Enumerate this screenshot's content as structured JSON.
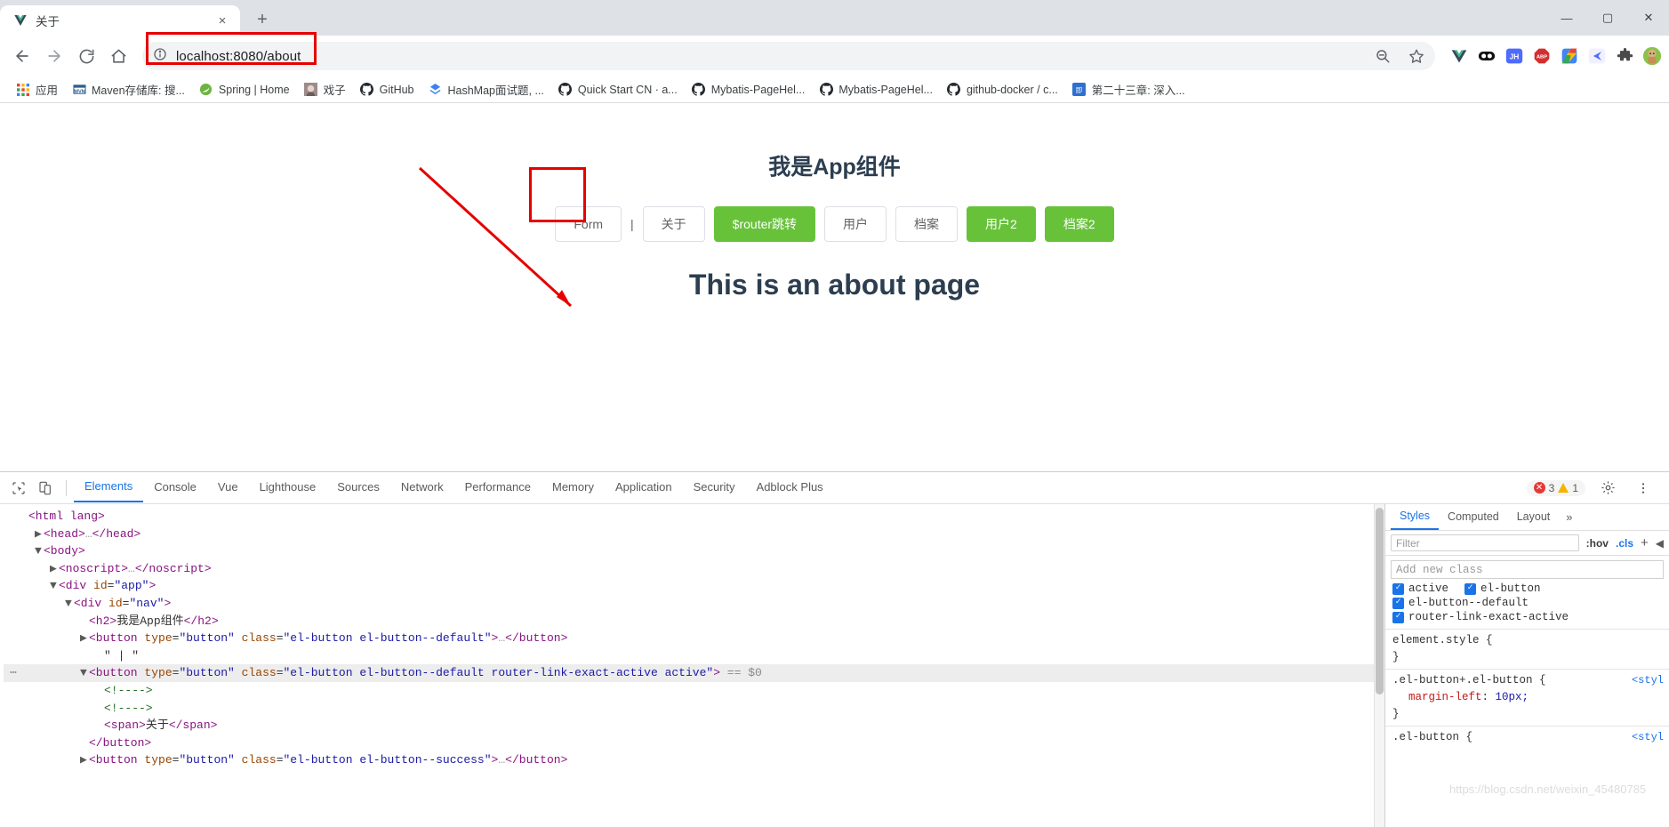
{
  "browser": {
    "tab": {
      "title": "关于",
      "favicon": "vue-icon",
      "close_label": "×"
    },
    "new_tab_label": "+",
    "window_controls": {
      "minimize": "—",
      "maximize": "▢",
      "close": "✕"
    },
    "nav": {
      "back": "←",
      "forward": "→",
      "reload": "⟳",
      "home": "⌂",
      "site_info": "ⓘ",
      "url": "localhost:8080/about",
      "zoom_icon": "search-minus-icon",
      "bookmark_star": "☆"
    },
    "extensions": [
      {
        "name": "vue-devtools-extension",
        "label": "V"
      },
      {
        "name": "dark-reader-extension",
        "label": "••"
      },
      {
        "name": "juejin-extension",
        "label": "JH"
      },
      {
        "name": "adblock-plus-extension",
        "label": "ABP"
      },
      {
        "name": "flash-extension",
        "label": "⚡"
      },
      {
        "name": "kite-extension",
        "label": "◀"
      },
      {
        "name": "extensions-puzzle",
        "label": "🧩"
      },
      {
        "name": "profile-avatar",
        "label": ""
      }
    ],
    "bookmarks": [
      {
        "label": "应用",
        "icon": "apps-grid-icon"
      },
      {
        "label": "Maven存储库: 搜...",
        "icon": "maven-icon"
      },
      {
        "label": "Spring | Home",
        "icon": "spring-leaf-icon"
      },
      {
        "label": "戏子",
        "icon": "anime-avatar-icon"
      },
      {
        "label": "GitHub",
        "icon": "github-icon"
      },
      {
        "label": "HashMap面试题, ...",
        "icon": "csdn-icon"
      },
      {
        "label": "Quick Start CN · a...",
        "icon": "github-icon"
      },
      {
        "label": "Mybatis-PageHel...",
        "icon": "github-icon"
      },
      {
        "label": "Mybatis-PageHel...",
        "icon": "github-icon"
      },
      {
        "label": "github-docker / c...",
        "icon": "github-icon"
      },
      {
        "label": "第二十三章: 深入...",
        "icon": "book-icon"
      }
    ]
  },
  "page": {
    "title": "我是App组件",
    "heading": "This is an about page",
    "separator": "|",
    "nav_buttons": [
      {
        "label": "Form",
        "type": "default"
      },
      {
        "label": "关于",
        "type": "default",
        "active": true
      },
      {
        "label": "$router跳转",
        "type": "success"
      },
      {
        "label": "用户",
        "type": "default"
      },
      {
        "label": "档案",
        "type": "default"
      },
      {
        "label": "用户2",
        "type": "success"
      },
      {
        "label": "档案2",
        "type": "success"
      }
    ]
  },
  "annotation": {
    "color": "#e60000"
  },
  "devtools": {
    "inspect_icon": "cursor-inspect-icon",
    "device_icon": "device-toolbar-icon",
    "tabs": [
      "Elements",
      "Console",
      "Vue",
      "Lighthouse",
      "Sources",
      "Network",
      "Performance",
      "Memory",
      "Application",
      "Security",
      "Adblock Plus"
    ],
    "active_tab": "Elements",
    "error_count": "3",
    "warning_count": "1",
    "settings_icon": "gear-icon",
    "menu_icon": "kebab-menu-icon",
    "dom_lines": [
      {
        "indent": 0,
        "parts": [
          {
            "c": "tw",
            "t": "<html lang>"
          }
        ],
        "clipped": true
      },
      {
        "indent": 1,
        "arrow": "▶",
        "parts": [
          {
            "c": "tw",
            "t": "<head>"
          },
          {
            "c": "dots",
            "t": "…"
          },
          {
            "c": "tw",
            "t": "</head>"
          }
        ]
      },
      {
        "indent": 1,
        "arrow": "▼",
        "parts": [
          {
            "c": "tw",
            "t": "<body>"
          }
        ]
      },
      {
        "indent": 2,
        "arrow": "▶",
        "parts": [
          {
            "c": "tw",
            "t": "<noscript>"
          },
          {
            "c": "dots",
            "t": "…"
          },
          {
            "c": "tw",
            "t": "</noscript>"
          }
        ]
      },
      {
        "indent": 2,
        "arrow": "▼",
        "parts": [
          {
            "c": "tw",
            "t": "<div "
          },
          {
            "c": "attr",
            "t": "id"
          },
          {
            "c": "eq",
            "t": "="
          },
          {
            "c": "val",
            "t": "\"app\""
          },
          {
            "c": "tw",
            "t": ">"
          }
        ]
      },
      {
        "indent": 3,
        "arrow": "▼",
        "parts": [
          {
            "c": "tw",
            "t": "<div "
          },
          {
            "c": "attr",
            "t": "id"
          },
          {
            "c": "eq",
            "t": "="
          },
          {
            "c": "val",
            "t": "\"nav\""
          },
          {
            "c": "tw",
            "t": ">"
          }
        ]
      },
      {
        "indent": 4,
        "parts": [
          {
            "c": "tw",
            "t": "<h2>"
          },
          {
            "c": "txt",
            "t": "我是App组件"
          },
          {
            "c": "tw",
            "t": "</h2>"
          }
        ]
      },
      {
        "indent": 4,
        "arrow": "▶",
        "parts": [
          {
            "c": "tw",
            "t": "<button "
          },
          {
            "c": "attr",
            "t": "type"
          },
          {
            "c": "eq",
            "t": "="
          },
          {
            "c": "val",
            "t": "\"button\""
          },
          {
            "c": "attr",
            "t": " class"
          },
          {
            "c": "eq",
            "t": "="
          },
          {
            "c": "val",
            "t": "\"el-button el-button--default\""
          },
          {
            "c": "tw",
            "t": ">"
          },
          {
            "c": "dots",
            "t": "…"
          },
          {
            "c": "tw",
            "t": "</button>"
          }
        ]
      },
      {
        "indent": 5,
        "parts": [
          {
            "c": "txt",
            "t": "\" | \""
          }
        ]
      },
      {
        "indent": 4,
        "arrow": "▼",
        "selected": true,
        "gutter": "⋯",
        "parts": [
          {
            "c": "tw",
            "t": "<button "
          },
          {
            "c": "attr",
            "t": "type"
          },
          {
            "c": "eq",
            "t": "="
          },
          {
            "c": "val",
            "t": "\"button\""
          },
          {
            "c": "attr",
            "t": " class"
          },
          {
            "c": "eq",
            "t": "="
          },
          {
            "c": "val",
            "t": "\"el-button el-button--default router-link-exact-active active\""
          },
          {
            "c": "tw",
            "t": ">"
          },
          {
            "c": "dollar",
            "t": " == $0"
          }
        ]
      },
      {
        "indent": 5,
        "parts": [
          {
            "c": "cmt",
            "t": "<!---->"
          }
        ]
      },
      {
        "indent": 5,
        "parts": [
          {
            "c": "cmt",
            "t": "<!---->"
          }
        ]
      },
      {
        "indent": 5,
        "parts": [
          {
            "c": "tw",
            "t": "<span>"
          },
          {
            "c": "txt",
            "t": "关于"
          },
          {
            "c": "tw",
            "t": "</span>"
          }
        ]
      },
      {
        "indent": 4,
        "parts": [
          {
            "c": "tw",
            "t": "</button>"
          }
        ]
      },
      {
        "indent": 4,
        "arrow": "▶",
        "parts": [
          {
            "c": "tw",
            "t": "<button "
          },
          {
            "c": "attr",
            "t": "type"
          },
          {
            "c": "eq",
            "t": "="
          },
          {
            "c": "val",
            "t": "\"button\""
          },
          {
            "c": "attr",
            "t": " class"
          },
          {
            "c": "eq",
            "t": "="
          },
          {
            "c": "val",
            "t": "\"el-button el-button--success\""
          },
          {
            "c": "tw",
            "t": ">"
          },
          {
            "c": "dots",
            "t": "…"
          },
          {
            "c": "tw",
            "t": "</button>"
          }
        ],
        "clipped": true
      }
    ],
    "styles": {
      "tabs": [
        "Styles",
        "Computed",
        "Layout"
      ],
      "more": "»",
      "active_tab": "Styles",
      "filter_placeholder": "Filter",
      "hov_label": ":hov",
      "cls_label": ".cls",
      "plus_label": "+",
      "arrow_label": "◀",
      "new_class_placeholder": "Add new class",
      "classes": [
        {
          "name": "active",
          "checked": true
        },
        {
          "name": "el-button",
          "checked": true
        },
        {
          "name": "el-button--default",
          "checked": true
        },
        {
          "name": "router-link-exact-active",
          "checked": true
        }
      ],
      "rules": [
        {
          "selector": "element.style {",
          "source": "",
          "props": [],
          "close": "}"
        },
        {
          "selector": ".el-button+.el-button {",
          "source": "<styl",
          "props": [
            {
              "key": "margin-left",
              "value": "10px;"
            }
          ],
          "close": "}"
        },
        {
          "selector": ".el-button {",
          "source": "<styl",
          "props": [],
          "close": ""
        }
      ]
    }
  },
  "watermark": "https://blog.csdn.net/weixin_45480785"
}
